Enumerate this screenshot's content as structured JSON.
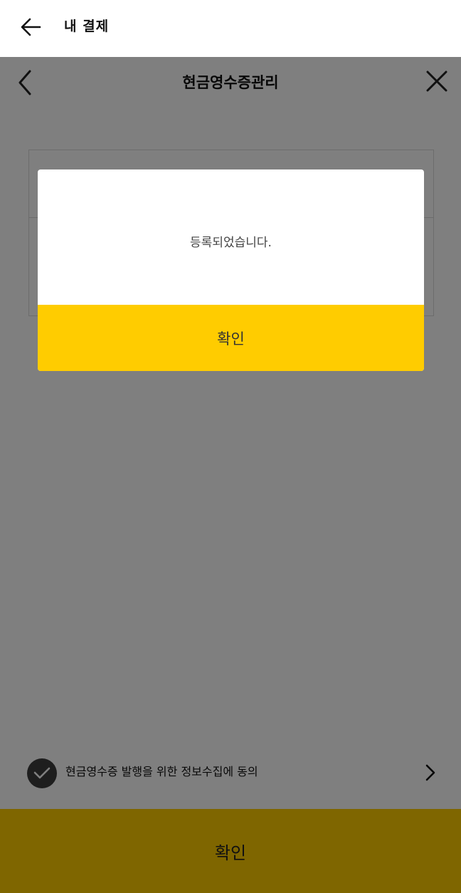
{
  "appbar": {
    "title": "내 결제"
  },
  "page": {
    "title": "현금영수증관리",
    "consent_text": "현금영수증 발행을 위한 정보수집에 동의",
    "confirm_label": "확인"
  },
  "dialog": {
    "message": "등록되었습니다.",
    "ok_label": "확인"
  },
  "colors": {
    "accent": "#ffcc00",
    "overlay": "rgba(0,0,0,0.5)"
  },
  "icons": [
    "arrow-left-icon",
    "chevron-left-icon",
    "close-icon",
    "checkmark-icon",
    "chevron-right-icon"
  ]
}
